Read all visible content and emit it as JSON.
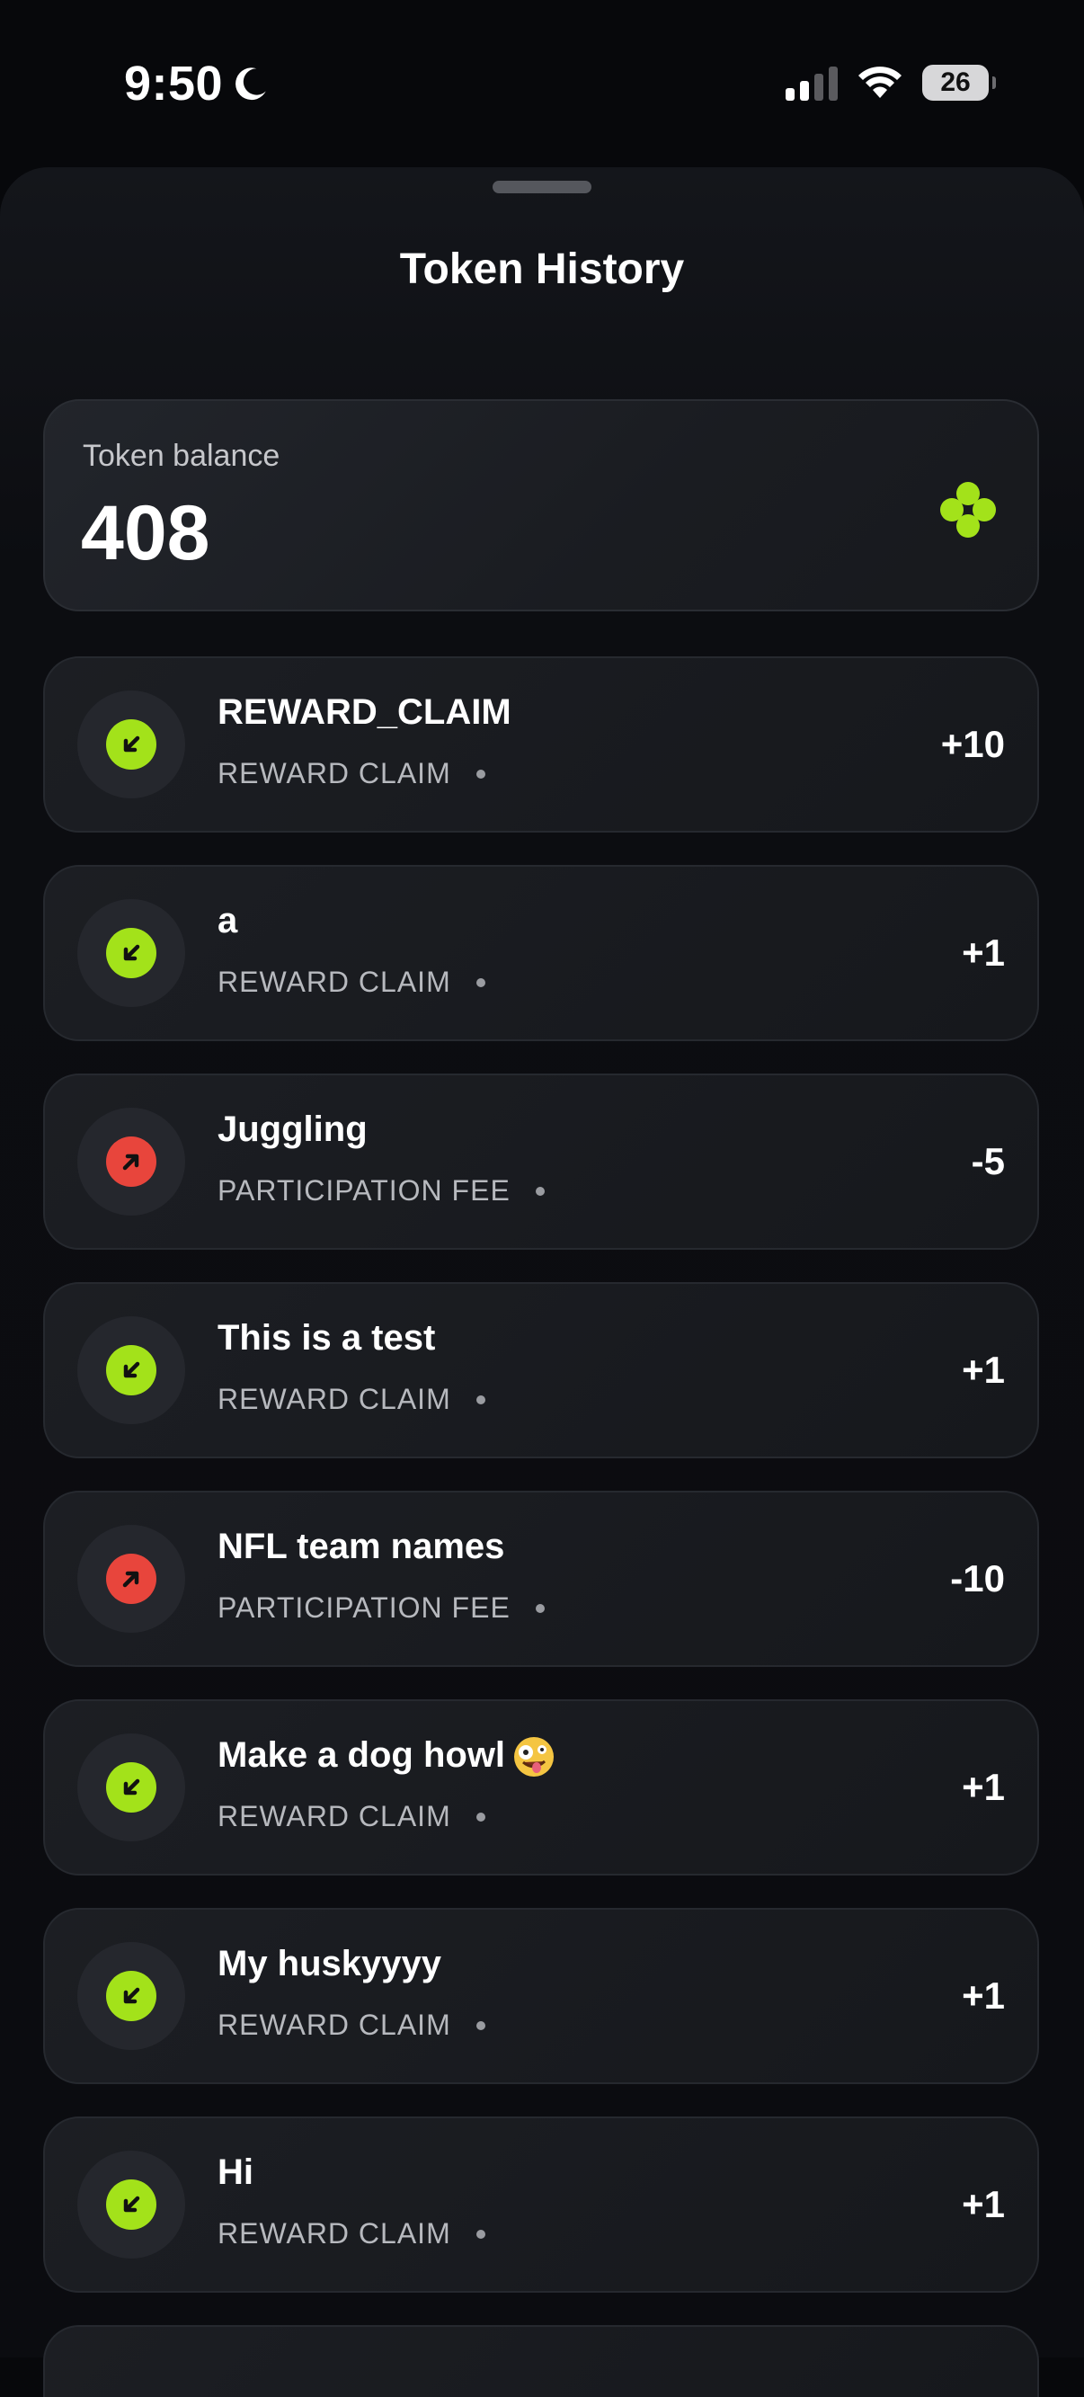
{
  "status_bar": {
    "time": "9:50",
    "battery": "26"
  },
  "sheet": {
    "title": "Token History"
  },
  "balance": {
    "label": "Token balance",
    "value": "408",
    "accent_color": "#a3e21a"
  },
  "transactions": [
    {
      "title": "REWARD_CLAIM",
      "subtitle": "REWARD CLAIM",
      "amount": "+10",
      "direction": "in",
      "icon": "arrow-down-left-icon"
    },
    {
      "title": "a",
      "subtitle": "REWARD CLAIM",
      "amount": "+1",
      "direction": "in",
      "icon": "arrow-down-left-icon"
    },
    {
      "title": "Juggling",
      "subtitle": "PARTICIPATION FEE",
      "amount": "-5",
      "direction": "out",
      "icon": "arrow-up-right-icon"
    },
    {
      "title": "This is a test",
      "subtitle": "REWARD CLAIM",
      "amount": "+1",
      "direction": "in",
      "icon": "arrow-down-left-icon"
    },
    {
      "title": "NFL team names",
      "subtitle": "PARTICIPATION FEE",
      "amount": "-10",
      "direction": "out",
      "icon": "arrow-up-right-icon"
    },
    {
      "title": "Make a dog howl",
      "subtitle": "REWARD CLAIM",
      "amount": "+1",
      "direction": "in",
      "icon": "arrow-down-left-icon",
      "trailing_emoji": "zany-face-emoji"
    },
    {
      "title": "My huskyyyy",
      "subtitle": "REWARD CLAIM",
      "amount": "+1",
      "direction": "in",
      "icon": "arrow-down-left-icon"
    },
    {
      "title": "Hi",
      "subtitle": "REWARD CLAIM",
      "amount": "+1",
      "direction": "in",
      "icon": "arrow-down-left-icon"
    }
  ],
  "colors": {
    "incoming": "#a3e21a",
    "outgoing": "#e8453c",
    "background": "#07080b"
  }
}
